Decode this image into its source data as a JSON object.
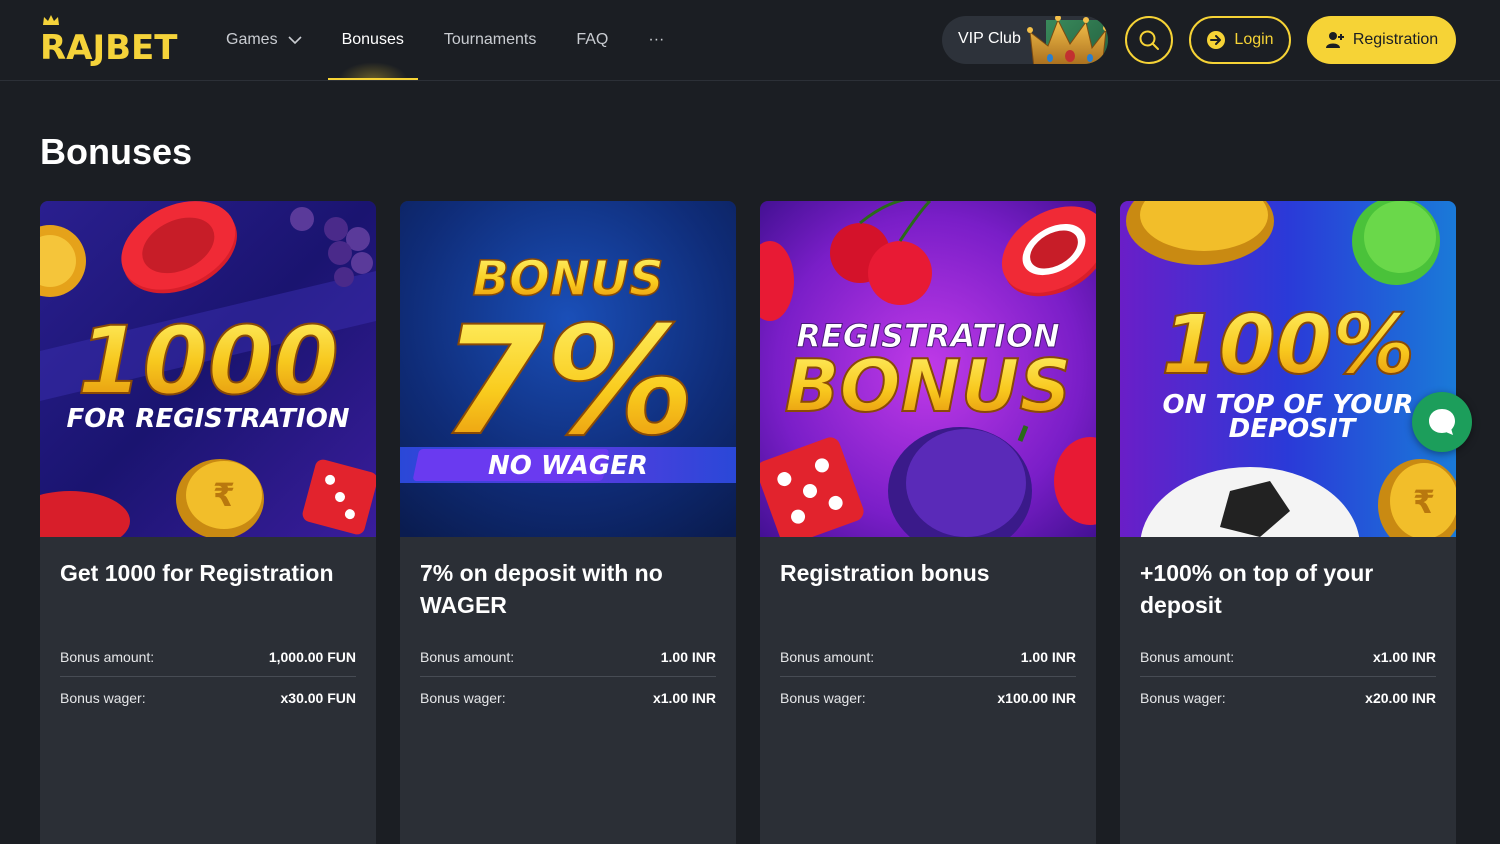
{
  "header": {
    "logo_text": "RAJBET",
    "nav": [
      {
        "label": "Games",
        "has_dropdown": true
      },
      {
        "label": "Bonuses",
        "active": true
      },
      {
        "label": "Tournaments"
      },
      {
        "label": "FAQ"
      },
      {
        "label": "···"
      }
    ],
    "vip_label": "VIP Club",
    "login_label": "Login",
    "registration_label": "Registration"
  },
  "page": {
    "title": "Bonuses"
  },
  "colors": {
    "accent": "#f6d336",
    "background": "#1b1e23",
    "card": "#2b2f36",
    "chat": "#1c9e5b"
  },
  "cards": [
    {
      "promo_line1": "1000",
      "promo_line2": "FOR REGISTRATION",
      "title": "Get 1000 for Registration",
      "rows": [
        {
          "label": "Bonus amount:",
          "value": "1,000.00 FUN"
        },
        {
          "label": "Bonus wager:",
          "value": "x30.00 FUN"
        }
      ]
    },
    {
      "promo_line1": "BONUS",
      "promo_line2": "7%",
      "promo_line3": "NO WAGER",
      "title": "7% on deposit with no WAGER",
      "rows": [
        {
          "label": "Bonus amount:",
          "value": "1.00 INR"
        },
        {
          "label": "Bonus wager:",
          "value": "x1.00 INR"
        }
      ]
    },
    {
      "promo_line1": "REGISTRATION",
      "promo_line2": "BONUS",
      "title": "Registration bonus",
      "rows": [
        {
          "label": "Bonus amount:",
          "value": "1.00 INR"
        },
        {
          "label": "Bonus wager:",
          "value": "x100.00 INR"
        }
      ]
    },
    {
      "promo_line1": "100%",
      "promo_line2": "ON TOP OF YOUR",
      "promo_line3": "DEPOSIT",
      "title": "+100% on top of your deposit",
      "rows": [
        {
          "label": "Bonus amount:",
          "value": "x1.00 INR"
        },
        {
          "label": "Bonus wager:",
          "value": "x20.00 INR"
        }
      ]
    }
  ]
}
